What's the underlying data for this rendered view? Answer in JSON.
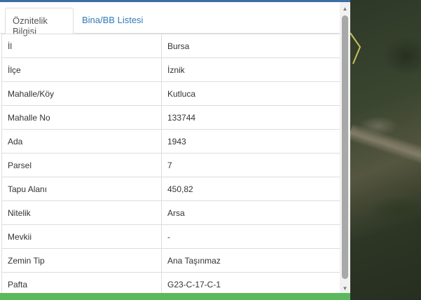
{
  "tabs": [
    {
      "label": "Öznitelik Bilgisi",
      "active": true
    },
    {
      "label": "Bina/BB Listesi",
      "active": false
    }
  ],
  "attributes": [
    {
      "key": "İl",
      "value": "Bursa"
    },
    {
      "key": "İlçe",
      "value": "İznik"
    },
    {
      "key": "Mahalle/Köy",
      "value": "Kutluca"
    },
    {
      "key": "Mahalle No",
      "value": "133744"
    },
    {
      "key": "Ada",
      "value": "1943"
    },
    {
      "key": "Parsel",
      "value": "7"
    },
    {
      "key": "Tapu Alanı",
      "value": "450,82"
    },
    {
      "key": "Nitelik",
      "value": "Arsa"
    },
    {
      "key": "Mevkii",
      "value": "-"
    },
    {
      "key": "Zemin Tip",
      "value": "Ana Taşınmaz"
    },
    {
      "key": "Pafta",
      "value": "G23-C-17-C-1"
    }
  ],
  "colors": {
    "accent": "#3a6ea5",
    "tab_link": "#337ab7",
    "bottom_bar": "#5cb85c",
    "parcel_outline": "#c8c060"
  },
  "icons": {
    "scroll_up": "triangle-up",
    "scroll_down": "triangle-down"
  }
}
